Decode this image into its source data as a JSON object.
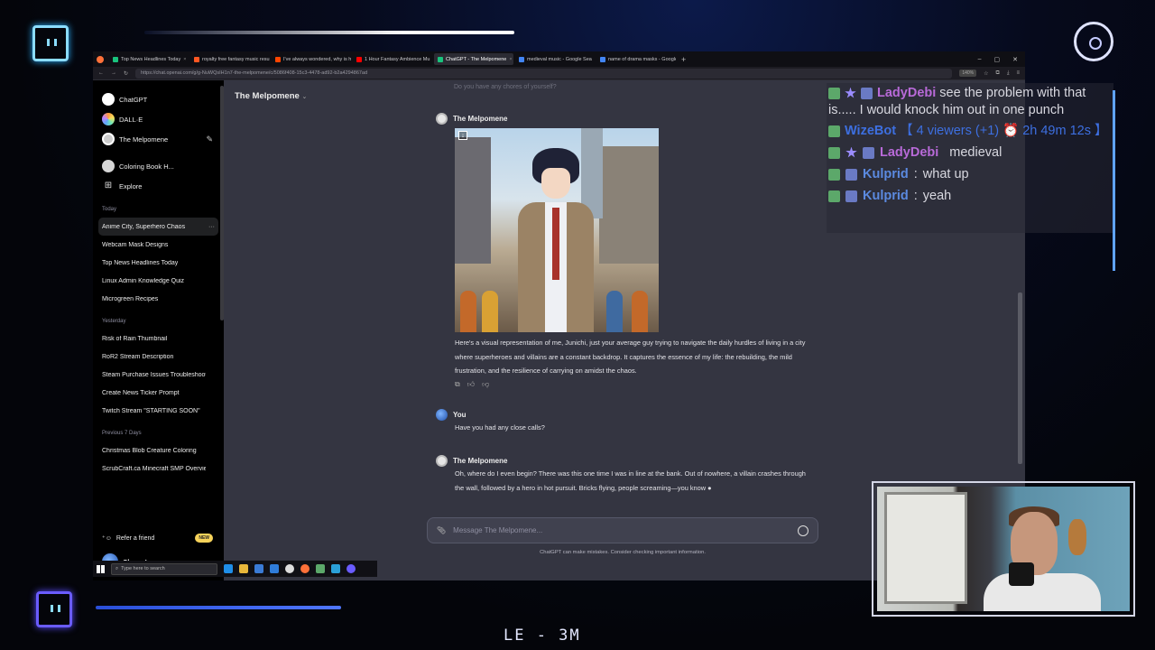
{
  "browser": {
    "tabs": [
      {
        "label": "Top News Headlines Today",
        "color": "#19c37d",
        "active": false
      },
      {
        "label": "royalty free fantasy music results",
        "color": "#ff5722",
        "active": false
      },
      {
        "label": "I've always wondered, why is h",
        "color": "#ff4500",
        "active": false
      },
      {
        "label": "1 Hour Fantasy Ambience Mu",
        "color": "#ff0000",
        "active": false
      },
      {
        "label": "ChatGPT - The Melpomene",
        "color": "#19c37d",
        "active": true
      },
      {
        "label": "medieval music - Google Sea",
        "color": "#4285f4",
        "active": false
      },
      {
        "label": "name of drama masks - Google",
        "color": "#4285f4",
        "active": false
      }
    ],
    "url": "https://chat.openai.com/g/g-NuWQsIH1n7-the-melpomene/c/5086f408-15c3-4478-ad92-b2a4294867ad",
    "zoom": "140%"
  },
  "sidebar": {
    "top_items": [
      {
        "label": "ChatGPT",
        "icon": "chatgpt-icon"
      },
      {
        "label": "DALL·E",
        "icon": "dalle-icon"
      },
      {
        "label": "The Melpomene",
        "icon": "melpomene-icon"
      }
    ],
    "gpt_items": [
      {
        "label": "Coloring Book H...",
        "icon": "coloring-book-icon"
      },
      {
        "label": "Explore",
        "icon": "grid-icon"
      }
    ],
    "sections": [
      {
        "title": "Today",
        "items": [
          "Anime City, Superhero Chaos",
          "Webcam Mask Designs",
          "Top News Headlines Today",
          "Linux Admin Knowledge Quiz",
          "Microgreen Recipes"
        ]
      },
      {
        "title": "Yesterday",
        "items": [
          "Risk of Rain Thumbnail",
          "RoR2 Stream Description",
          "Steam Purchase Issues Troubleshooting",
          "Create News Ticker Prompt",
          "Twitch Stream \"STARTING SOON\""
        ]
      },
      {
        "title": "Previous 7 Days",
        "items": [
          "Christmas Blob Creature Coloring",
          "ScrubCraft.ca Minecraft SMP Overview"
        ]
      }
    ],
    "refer": "Refer a friend",
    "new_badge": "NEW",
    "user": "Chase Long"
  },
  "main": {
    "model_title": "The Melpomene",
    "faded_text": "Do you have any chores of yourself?",
    "messages": [
      {
        "author": "The Melpomene",
        "text": "Here's a visual representation of me, Junichi, just your average guy trying to navigate the daily hurdles of living in a city where superheroes and villains are a constant backdrop. It captures the essence of my life: the rebuilding, the mild frustration, and the resilience of carrying on amidst the chaos."
      },
      {
        "author": "You",
        "text": "Have you had any close calls?"
      },
      {
        "author": "The Melpomene",
        "text": "Oh, where do I even begin? There was this one time I was in line at the bank. Out of nowhere, a villain crashes through the wall, followed by a hero in hot pursuit. Bricks flying, people screaming—you know ●"
      }
    ],
    "composer_placeholder": "Message The Melpomene...",
    "disclaimer": "ChatGPT can make mistakes. Consider checking important information."
  },
  "taskbar": {
    "search_placeholder": "Type here to search"
  },
  "stream_chat": [
    {
      "nick": "LadyDebi",
      "nick_color": "#b86ad8",
      "badges": [
        "green",
        "star",
        "crown"
      ],
      "text": "see the problem with that is..... I would knock him out in one punch",
      "wrap": true
    },
    {
      "nick": "WizeBot",
      "nick_color": "#3d6fe0",
      "badges": [
        "green"
      ],
      "text": "【 4 viewers (+1) ⏰ 2h 49m 12s 】",
      "wrap": true
    },
    {
      "nick": "LadyDebi",
      "nick_color": "#b86ad8",
      "badges": [
        "green",
        "star",
        "crown"
      ],
      "text": "medieval",
      "wrap": false
    },
    {
      "nick": "Kulprid",
      "nick_color": "#5b8ae0",
      "badges": [
        "green",
        "crown"
      ],
      "text": "what up",
      "wrap": false
    },
    {
      "nick": "Kulprid",
      "nick_color": "#5b8ae0",
      "badges": [
        "green",
        "crown"
      ],
      "text": "yeah",
      "wrap": false
    }
  ],
  "overlay": {
    "countdown": "LE - 3M"
  }
}
